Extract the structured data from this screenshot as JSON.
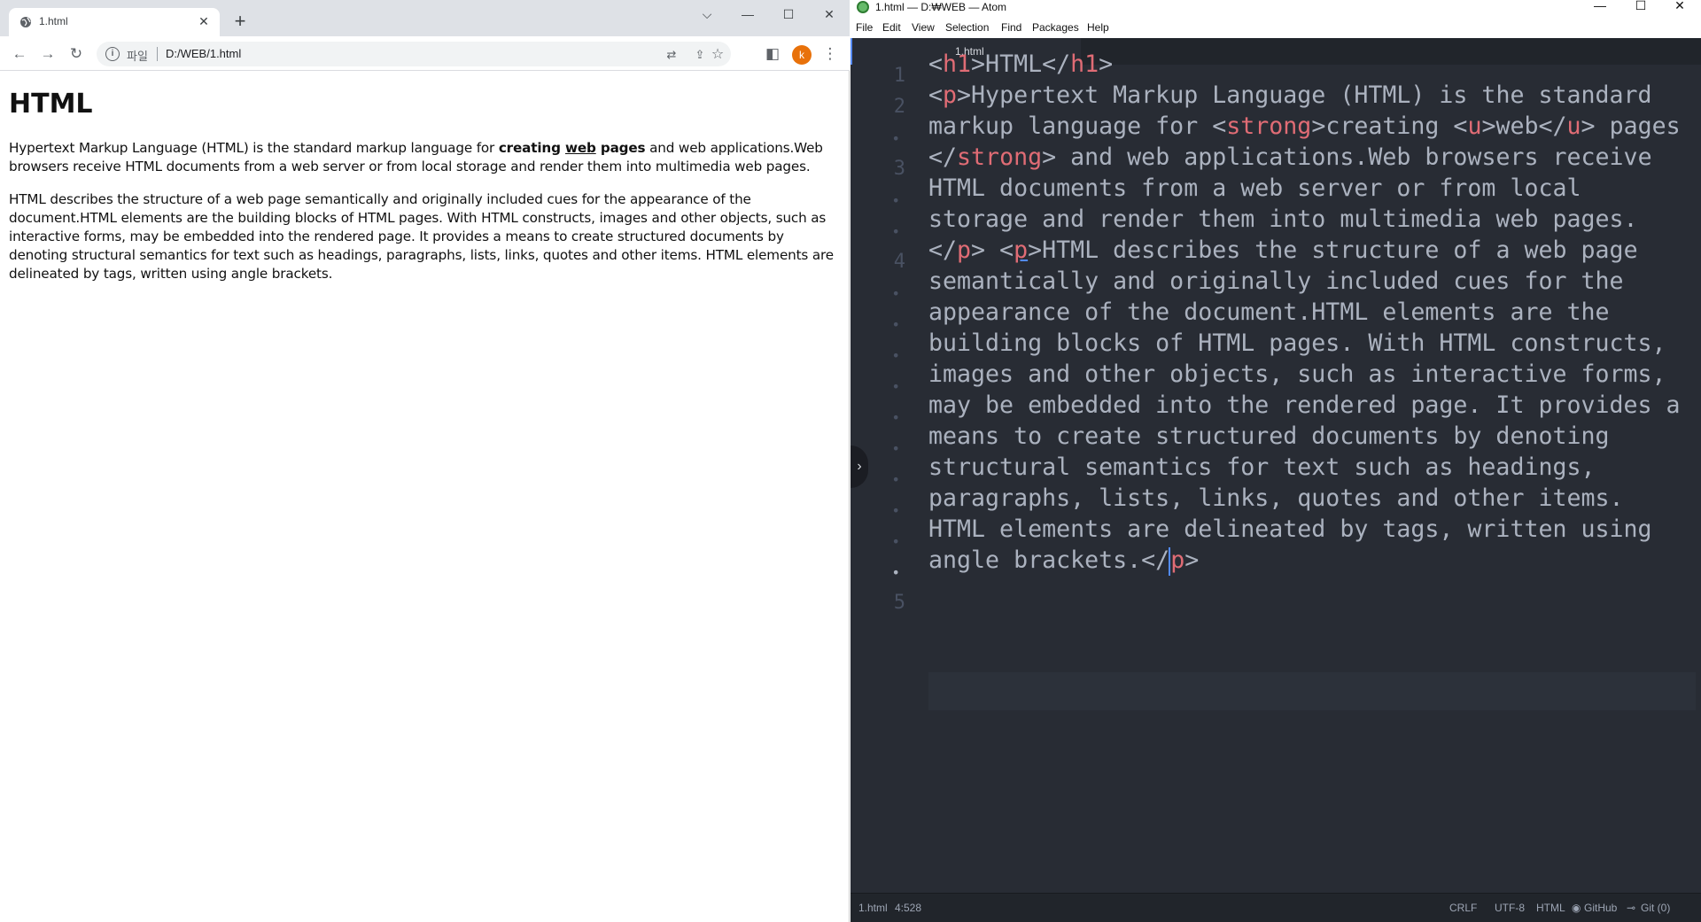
{
  "chrome": {
    "tab_title": "1.html",
    "tab_close": "✕",
    "new_tab": "+",
    "win_controls": {
      "dropdown": "⌵",
      "minimize": "—",
      "maximize": "☐",
      "close": "✕"
    },
    "nav": {
      "back": "←",
      "forward": "→",
      "reload": "↻"
    },
    "omnibox": {
      "info": "i",
      "scheme_label": "파일",
      "url": "D:/WEB/1.html"
    },
    "toolbar_icons": {
      "translate": "⇄",
      "share": "⇪",
      "bookmark": "☆",
      "sidepanel": "◧",
      "menu": "⋮"
    },
    "profile_initial": "k"
  },
  "page": {
    "h1": "HTML",
    "p1_before": "Hypertext Markup Language (HTML) is the standard markup language for ",
    "p1_strong_a": "creating ",
    "p1_u": "web",
    "p1_strong_b": " pages",
    "p1_after": " and web applications.Web browsers receive HTML documents from a web server or from local storage and render them into multimedia web pages.",
    "p2": "HTML describes the structure of a web page semantically and originally included cues for the appearance of the document.HTML elements are the building blocks of HTML pages. With HTML constructs, images and other objects, such as interactive forms, may be embedded into the rendered page. It provides a means to create structured documents by denoting structural semantics for text such as headings, paragraphs, lists, links, quotes and other items. HTML elements are delineated by tags, written using angle brackets."
  },
  "atom": {
    "window_title": "1.html — D:₩WEB — Atom",
    "win_controls": {
      "minimize": "—",
      "maximize": "☐",
      "close": "✕"
    },
    "menu": [
      "File",
      "Edit",
      "View",
      "Selection",
      "Find",
      "Packages",
      "Help"
    ],
    "tab_title": "1.html",
    "gutter": [
      "1",
      "2",
      "•",
      "3",
      "•",
      "•",
      "4",
      "•",
      "•",
      "•",
      "•",
      "•",
      "•",
      "•",
      "•",
      "•",
      "•",
      "5"
    ],
    "code": {
      "l1": [
        "<",
        "h1",
        ">HTML</",
        "h1",
        ">"
      ],
      "l2": [
        "<",
        "p",
        ">Hypertext Markup Language (HTML) is the standard"
      ],
      "l3": [
        "markup language for <",
        "strong",
        ">creating <",
        "u",
        ">web</",
        "u",
        "> pages"
      ],
      "l4": [
        "</",
        "strong",
        "> and web applications.Web browsers receive"
      ],
      "l5": "HTML documents from a web server or from local",
      "l6": "storage and render them into multimedia web pages.",
      "l7": [
        "</",
        "p",
        "> <",
        "p",
        ">HTML describes the structure of a web page"
      ],
      "l8": "semantically and originally included cues for the",
      "l9": "appearance of the document.HTML elements are the",
      "l10": "building blocks of HTML pages. With HTML constructs,",
      "l11": "images and other objects, such as interactive forms,",
      "l12": "may be embedded into the rendered page. It provides a",
      "l13": "means to create structured documents by denoting",
      "l14": "structural semantics for text such as headings,",
      "l15": "paragraphs, lists, links, quotes and other items.",
      "l16": "HTML elements are delineated by tags, written using",
      "l17": [
        "angle brackets.</",
        "p",
        ">"
      ]
    },
    "side_toggle": "›",
    "status": {
      "file": "1.html",
      "cursor_pos": "4:528",
      "line_ending": "CRLF",
      "encoding": "UTF-8",
      "grammar": "HTML",
      "github": "GitHub",
      "git": "Git (0)"
    }
  }
}
